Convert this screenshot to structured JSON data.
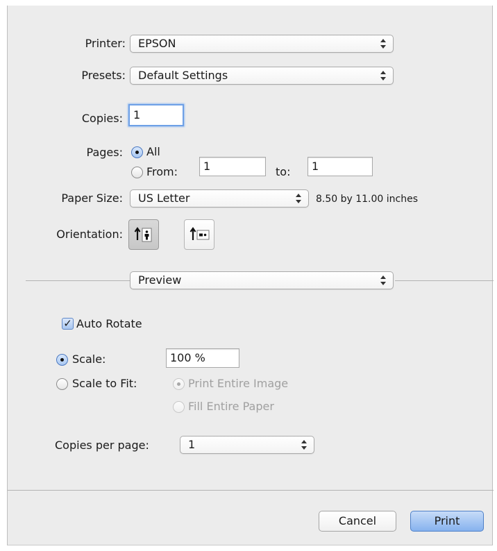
{
  "printer": {
    "label": "Printer:",
    "value": "EPSON"
  },
  "presets": {
    "label": "Presets:",
    "value": "Default Settings"
  },
  "copies": {
    "label": "Copies:",
    "value": "1"
  },
  "pages": {
    "label": "Pages:",
    "all_label": "All",
    "from_label": "From:",
    "from_value": "1",
    "to_label": "to:",
    "to_value": "1",
    "selected": "All"
  },
  "paper_size": {
    "label": "Paper Size:",
    "value": "US Letter",
    "dimensions": "8.50 by 11.00 inches"
  },
  "orientation": {
    "label": "Orientation:",
    "options": [
      "portrait",
      "landscape"
    ],
    "selected": "portrait"
  },
  "section_popup": {
    "value": "Preview"
  },
  "preview": {
    "auto_rotate": {
      "label": "Auto Rotate",
      "checked": true
    },
    "scale": {
      "label": "Scale:",
      "value": "100 %",
      "selected": true
    },
    "scale_to_fit": {
      "label": "Scale to Fit:",
      "options": [
        "Print Entire Image",
        "Fill Entire Paper"
      ],
      "selected_option": "Print Entire Image",
      "enabled": false
    },
    "copies_per_page": {
      "label": "Copies per page:",
      "value": "1"
    }
  },
  "buttons": {
    "cancel": "Cancel",
    "print": "Print"
  }
}
